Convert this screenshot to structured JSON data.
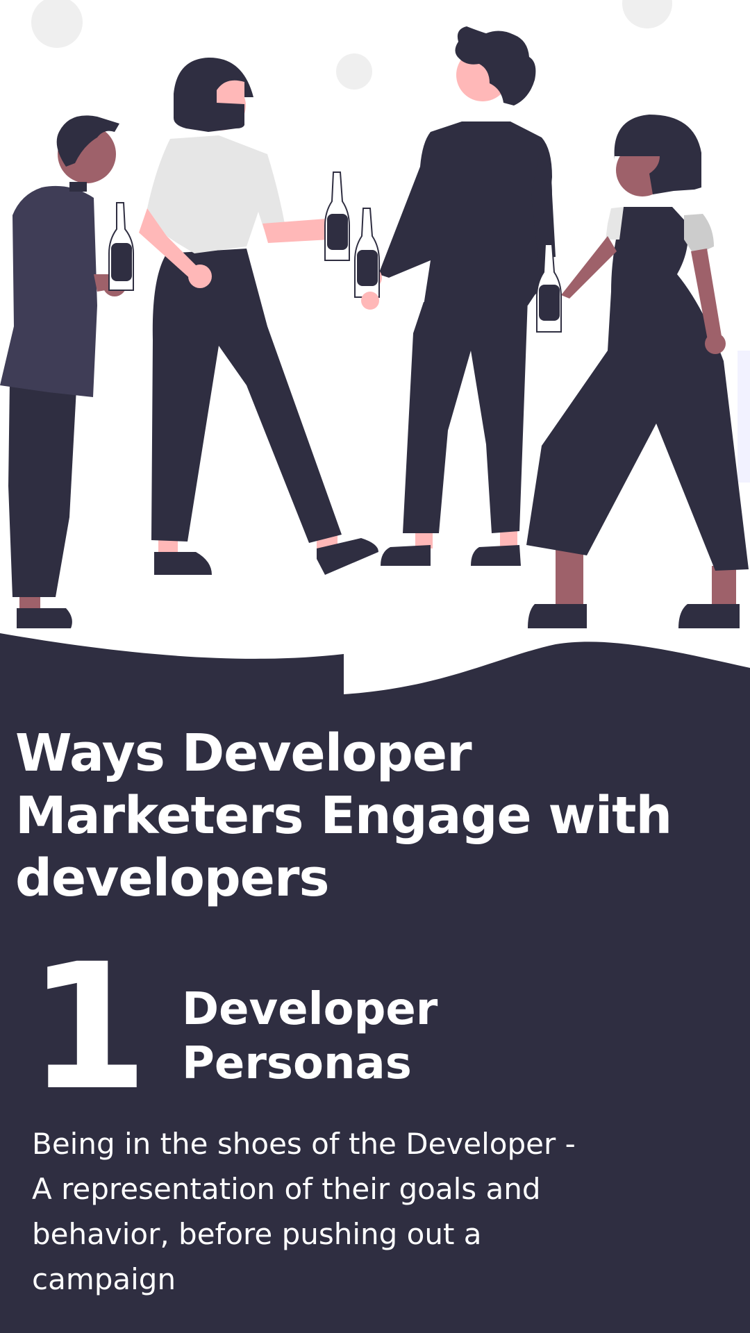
{
  "colors": {
    "panel": "#2f2e41",
    "text": "#ffffff",
    "skin_light": "#ffb8b8",
    "skin_dark": "#9e616a",
    "shirt_light": "#e6e6e6",
    "jacket": "#3f3d56",
    "dot": "#efefef"
  },
  "illustration": {
    "subject": "four-people-socializing-with-bottles",
    "icons": [
      "person-icon",
      "bottle-icon"
    ]
  },
  "headline": {
    "line1": "Ways Developer",
    "line2": "Marketers Engage with",
    "line3": "developers"
  },
  "item": {
    "number": "1",
    "title_line1": "Developer",
    "title_line2": "Personas",
    "body_line1": "Being in the shoes of the Developer -",
    "body_line2": "A representation of their goals and",
    "body_line3": "behavior, before pushing out a",
    "body_line4": "campaign"
  }
}
